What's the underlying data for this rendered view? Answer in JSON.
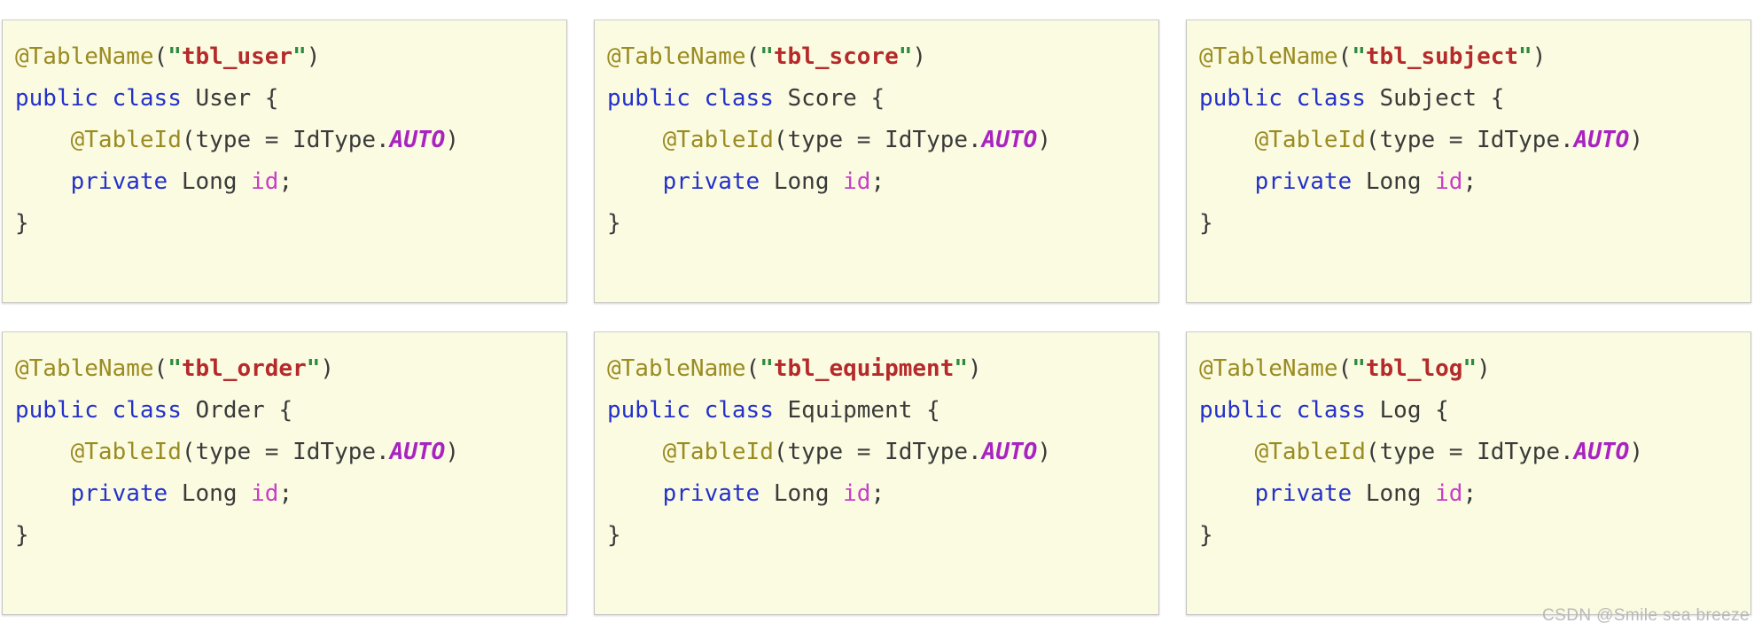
{
  "watermark": "CSDN @Smile sea breeze",
  "colors": {
    "card_background": "#fbfbe1",
    "card_border": "#c4c4c4",
    "page_background": "#ffffff",
    "annotation": "#9a8b22",
    "string_literal": "#b52a2a",
    "string_quote": "#2c8b3e",
    "keyword": "#2431cb",
    "type_name": "#3a3a3a",
    "enum_constant": "#a824c0",
    "field_name": "#c83fc8",
    "watermark": "#b9b9b9"
  },
  "syntax": {
    "annotation_table_name": "@TableName",
    "annotation_table_id": "@TableId",
    "open_paren": "(",
    "close_paren": ")",
    "quote": "\"",
    "keyword_public": "public",
    "keyword_class": "class",
    "keyword_private": "private",
    "open_brace": "{",
    "close_brace": "}",
    "attr_type": "type",
    "equals": " = ",
    "id_type": "IdType",
    "dot": ".",
    "enum_auto": "AUTO",
    "field_type": "Long",
    "field_name": "id",
    "semicolon": ";",
    "space": " "
  },
  "cards": [
    {
      "table_name": "tbl_user",
      "class_name": "User",
      "id_strategy": "AUTO",
      "field_type": "Long",
      "field_name": "id"
    },
    {
      "table_name": "tbl_score",
      "class_name": "Score",
      "id_strategy": "AUTO",
      "field_type": "Long",
      "field_name": "id"
    },
    {
      "table_name": "tbl_subject",
      "class_name": "Subject",
      "id_strategy": "AUTO",
      "field_type": "Long",
      "field_name": "id"
    },
    {
      "table_name": "tbl_order",
      "class_name": "Order",
      "id_strategy": "AUTO",
      "field_type": "Long",
      "field_name": "id"
    },
    {
      "table_name": "tbl_equipment",
      "class_name": "Equipment",
      "id_strategy": "AUTO",
      "field_type": "Long",
      "field_name": "id"
    },
    {
      "table_name": "tbl_log",
      "class_name": "Log",
      "id_strategy": "AUTO",
      "field_type": "Long",
      "field_name": "id"
    }
  ]
}
